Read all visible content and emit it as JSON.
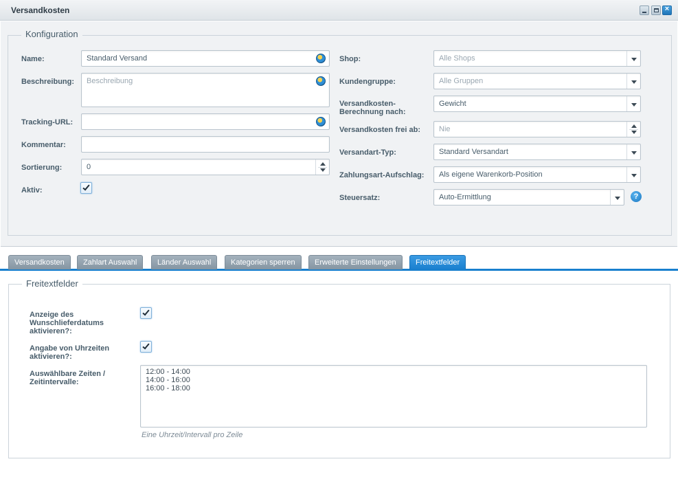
{
  "window": {
    "title": "Versandkosten"
  },
  "config": {
    "legend": "Konfiguration",
    "name": {
      "label": "Name:",
      "value": "Standard Versand"
    },
    "beschreibung": {
      "label": "Beschreibung:",
      "placeholder": "Beschreibung"
    },
    "tracking": {
      "label": "Tracking-URL:",
      "value": ""
    },
    "kommentar": {
      "label": "Kommentar:",
      "value": ""
    },
    "sortierung": {
      "label": "Sortierung:",
      "value": "0"
    },
    "aktiv": {
      "label": "Aktiv:",
      "checked": true
    },
    "shop": {
      "label": "Shop:",
      "placeholder": "Alle Shops"
    },
    "kundengruppe": {
      "label": "Kundengruppe:",
      "placeholder": "Alle Gruppen"
    },
    "berechnung": {
      "label_line1": "Versandkosten-",
      "label_line2": "Berechnung nach:",
      "value": "Gewicht"
    },
    "frei_ab": {
      "label": "Versandkosten frei ab:",
      "placeholder": "Nie"
    },
    "versandart_typ": {
      "label": "Versandart-Typ:",
      "value": "Standard Versandart"
    },
    "zahlungsart": {
      "label": "Zahlungsart-Aufschlag:",
      "value": "Als eigene Warenkorb-Position"
    },
    "steuersatz": {
      "label": "Steuersatz:",
      "value": "Auto-Ermittlung"
    },
    "help_glyph": "?"
  },
  "tabs": [
    {
      "label": "Versandkosten",
      "active": false
    },
    {
      "label": "Zahlart Auswahl",
      "active": false
    },
    {
      "label": "Länder Auswahl",
      "active": false
    },
    {
      "label": "Kategorien sperren",
      "active": false
    },
    {
      "label": "Erweiterte Einstellungen",
      "active": false
    },
    {
      "label": "Freitextfelder",
      "active": true
    }
  ],
  "freitext": {
    "legend": "Freitextfelder",
    "wunsch": {
      "line1": "Anzeige des",
      "line2": "Wunschlieferdatums",
      "line3": "aktivieren?:",
      "checked": true
    },
    "uhrzeiten": {
      "line1": "Angabe von Uhrzeiten",
      "line2": "aktivieren?:",
      "checked": true
    },
    "zeiten": {
      "line1": "Auswählbare Zeiten /",
      "line2": "Zeitintervalle:",
      "value": "12:00 - 14:00\n14:00 - 16:00\n16:00 - 18:00"
    },
    "hint": "Eine Uhrzeit/Intervall pro Zeile"
  },
  "colors": {
    "accent": "#1980ce",
    "tab_inactive": "#8d9ca8",
    "panel_bg": "#f0f2f4"
  },
  "icons": {
    "globe": "globe-icon",
    "help": "help-icon",
    "check": "checkmark-icon"
  }
}
